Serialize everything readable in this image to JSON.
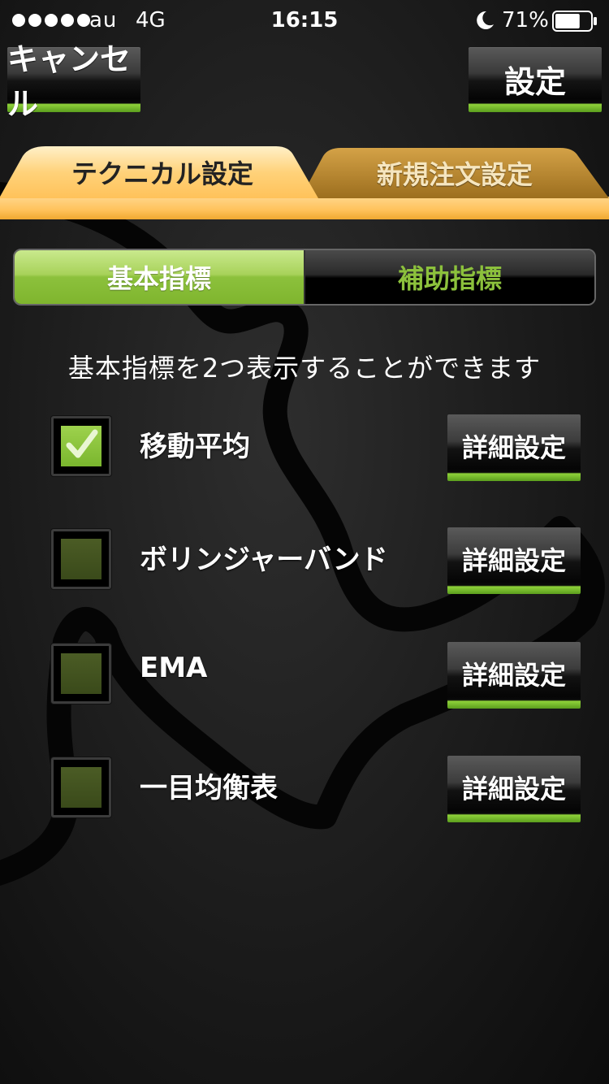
{
  "status_bar": {
    "carrier": "au",
    "network": "4G",
    "time": "16:15",
    "battery_percent": "71%",
    "battery_level": 0.71
  },
  "nav": {
    "cancel_label": "キャンセル",
    "set_label": "設定"
  },
  "tabs": [
    {
      "label": "テクニカル設定",
      "active": true
    },
    {
      "label": "新規注文設定",
      "active": false
    }
  ],
  "segments": [
    {
      "label": "基本指標",
      "active": true
    },
    {
      "label": "補助指標",
      "active": false
    }
  ],
  "description": "基本指標を2つ表示することができます",
  "indicators": [
    {
      "label": "移動平均",
      "checked": true,
      "detail_label": "詳細設定"
    },
    {
      "label": "ボリンジャーバンド",
      "checked": false,
      "detail_label": "詳細設定"
    },
    {
      "label": "EMA",
      "checked": false,
      "detail_label": "詳細設定"
    },
    {
      "label": "一目均衡表",
      "checked": false,
      "detail_label": "詳細設定"
    }
  ],
  "colors": {
    "accent_green": "#8cc13c",
    "tab_orange": "#ffc25a",
    "tab_inactive": "#b8862e"
  }
}
